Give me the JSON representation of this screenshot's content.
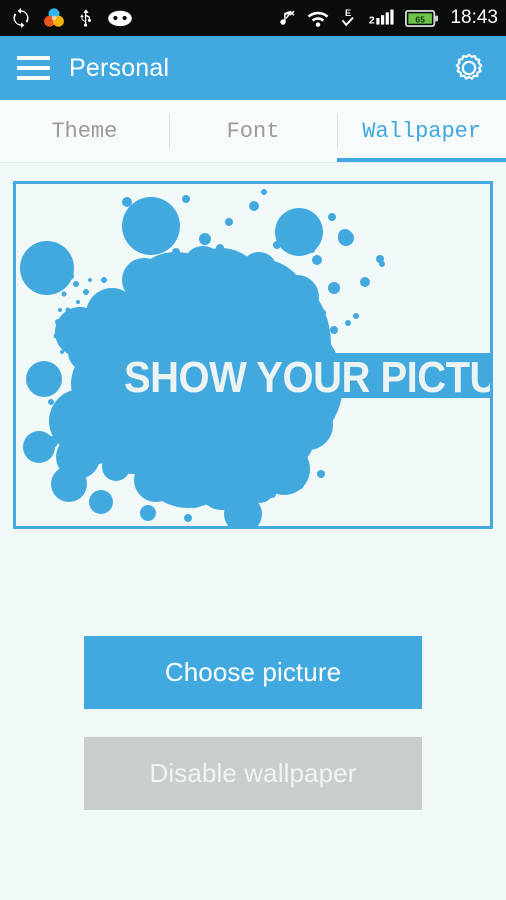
{
  "status_bar": {
    "time": "18:43",
    "battery_level": "65",
    "signal_label": "2",
    "data_network_label": "E",
    "icons": [
      {
        "name": "sync-icon",
        "label": "sync"
      },
      {
        "name": "color-circles-icon",
        "label": "color filter"
      },
      {
        "name": "usb-icon",
        "label": "usb connected"
      },
      {
        "name": "cyanogenmod-head-icon",
        "label": "cyanogenmod"
      },
      {
        "name": "sound-muted-icon",
        "label": "silent mode"
      },
      {
        "name": "wifi-icon",
        "label": "wifi"
      },
      {
        "name": "edge-data-icon",
        "label": "edge data"
      },
      {
        "name": "cell-signal-icon",
        "label": "cellular signal"
      },
      {
        "name": "battery-icon",
        "label": "battery"
      }
    ]
  },
  "app_bar": {
    "title": "Personal",
    "menu_icon": "hamburger-menu-icon",
    "settings_icon": "gear-icon"
  },
  "tabs": [
    {
      "label": "Theme",
      "active": false
    },
    {
      "label": "Font",
      "active": false
    },
    {
      "label": "Wallpaper",
      "active": true
    }
  ],
  "preview": {
    "name": "wallpaper-preview",
    "overlay_text": "SHOW YOUR PICTURE"
  },
  "buttons": {
    "choose_picture": "Choose picture",
    "disable_wallpaper": "Disable wallpaper"
  },
  "colors": {
    "accent": "#41A9E0",
    "background": "#F1F8F8",
    "tab_bar": "#F7FBFB",
    "tab_inactive_text": "#9A9A9A",
    "disabled_button": "#C9CDCE",
    "disabled_button_text": "#F0F4F4",
    "status_bar": "#0C0C0C",
    "splatter_blue": "#42A9DF"
  }
}
